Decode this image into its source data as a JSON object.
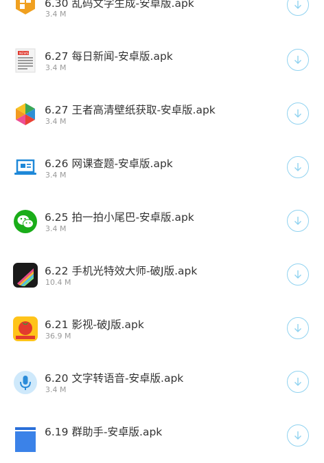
{
  "files": [
    {
      "name": "6.30 乱码文字生成-安卓版.apk",
      "size": "3.4 M",
      "icon": "orange-blocks-icon"
    },
    {
      "name": "6.27 每日新闻-安卓版.apk",
      "size": "3.4 M",
      "icon": "news-icon"
    },
    {
      "name": "6.27 王者高清壁纸获取-安卓版.apk",
      "size": "3.4 M",
      "icon": "colorful-pinwheel-icon"
    },
    {
      "name": "6.26 网课查题-安卓版.apk",
      "size": "3.4 M",
      "icon": "laptop-icon"
    },
    {
      "name": "6.25 拍一拍小尾巴-安卓版.apk",
      "size": "3.4 M",
      "icon": "wechat-icon"
    },
    {
      "name": "6.22 手机光特效大师-破J版.apk",
      "size": "10.4 M",
      "icon": "light-effect-icon"
    },
    {
      "name": "6.21 影视-破J版.apk",
      "size": "36.9 M",
      "icon": "tomato-icon"
    },
    {
      "name": "6.20 文字转语音-安卓版.apk",
      "size": "3.4 M",
      "icon": "microphone-icon"
    },
    {
      "name": "6.19 群助手-安卓版.apk",
      "size": "",
      "icon": "blue-box-icon"
    }
  ],
  "download_icon": "download-icon",
  "colors": {
    "download_ring": "#8fd2f0",
    "title": "#333333",
    "size": "#999999"
  }
}
